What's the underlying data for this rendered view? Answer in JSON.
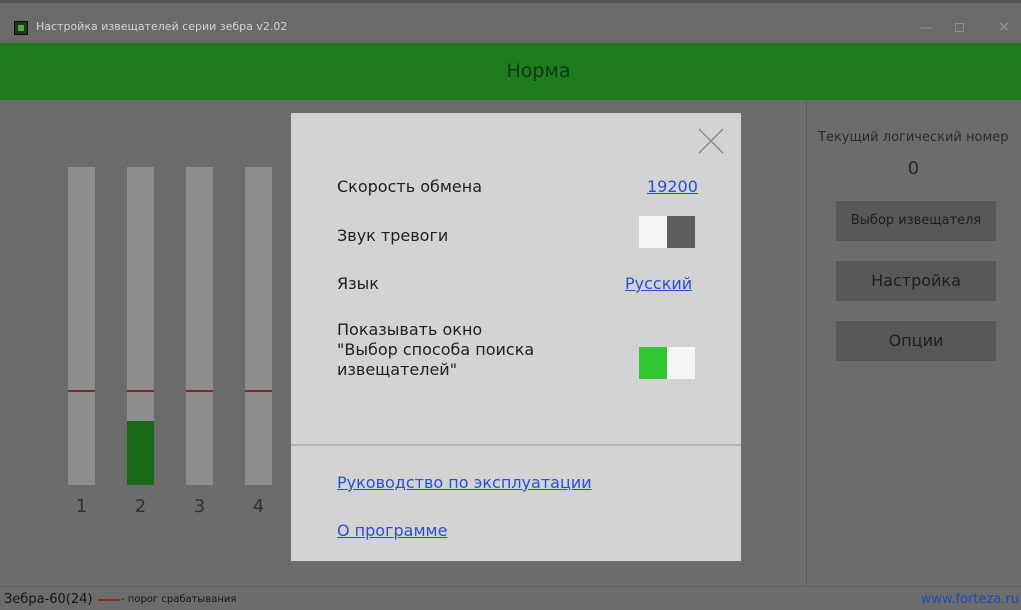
{
  "window": {
    "title": "Настройка извещателей серии зебра v2.02",
    "icon": "app-icon",
    "controls": {
      "minimize": "—",
      "maximize_icon": "maximize-icon",
      "close": "✕"
    }
  },
  "status": {
    "text": "Норма",
    "color": "#1e7b1e"
  },
  "channels": [
    {
      "label": "1",
      "level": 0.0,
      "threshold": 0.3
    },
    {
      "label": "2",
      "level": 0.2,
      "threshold": 0.3
    },
    {
      "label": "3",
      "level": 0.0,
      "threshold": 0.3
    },
    {
      "label": "4",
      "level": 0.0,
      "threshold": 0.3
    }
  ],
  "right_panel": {
    "caption": "Текущий логический номер",
    "number": "0",
    "buttons": {
      "select_detector": "Выбор извещателя",
      "settings": "Настройка",
      "options": "Опции"
    }
  },
  "options_dialog": {
    "close_icon": "close-icon",
    "exchange_speed": {
      "label": "Скорость обмена",
      "value": "19200"
    },
    "alarm_sound": {
      "label": "Звук тревоги",
      "enabled": false
    },
    "language": {
      "label": "Язык",
      "value": "Русский"
    },
    "show_search_window": {
      "label_lines": [
        "Показывать окно",
        "\"Выбор способа поиска",
        "извещателей\""
      ],
      "enabled": true
    },
    "links": {
      "manual": "Руководство по эксплуатации",
      "about": "О программе"
    }
  },
  "footer": {
    "device": "Зебра-60(24)",
    "legend": "- порог срабатывания",
    "site": "www.forteza.ru"
  },
  "colors": {
    "threshold": "#8a2424",
    "level_fill": "#1a681a",
    "toggle_on": "#33c733",
    "link": "#2a4fd2"
  }
}
